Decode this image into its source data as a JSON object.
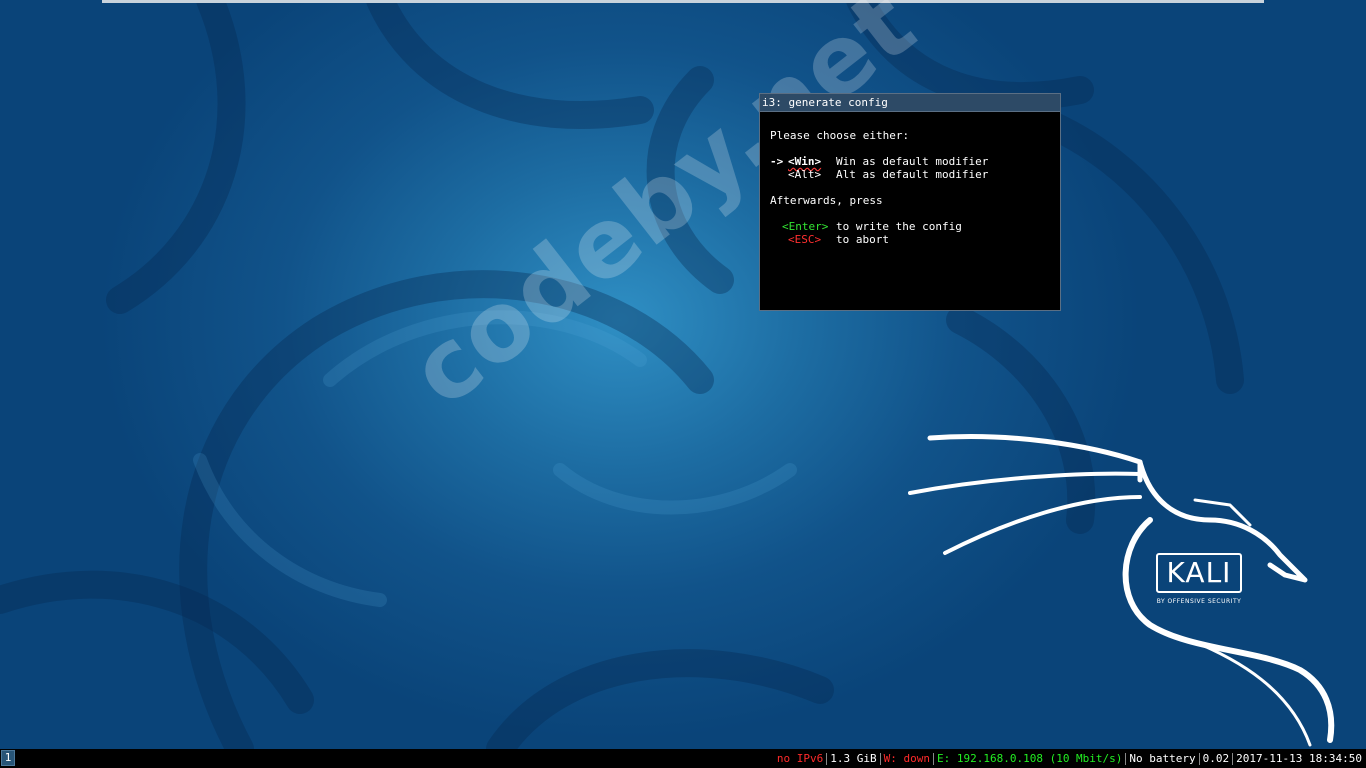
{
  "dialog": {
    "title": "i3: generate config",
    "prompt": "Please choose either:",
    "options": [
      {
        "arrow": "->",
        "key": "<Win>",
        "description": "Win as default modifier"
      },
      {
        "arrow": "",
        "key": "<Alt>",
        "description": "Alt as default modifier"
      }
    ],
    "afterwards": "Afterwards, press",
    "actions": [
      {
        "key": "<Enter>",
        "description": "to write the config",
        "color": "#33e433"
      },
      {
        "key": "<ESC>",
        "description": "to abort",
        "color": "#ff3030"
      }
    ]
  },
  "desktop": {
    "watermark": "codeby.net",
    "logo_wordmark": "KALI",
    "logo_tagline": "BY OFFENSIVE SECURITY"
  },
  "bar": {
    "workspace": "1",
    "status": {
      "ipv6": "no IPv6",
      "disk": "1.3 GiB",
      "wireless": "W: down",
      "ethernet": "E: 192.168.0.108 (10 Mbit/s)",
      "battery": "No battery",
      "load": "0.02",
      "datetime": "2017-11-13 18:34:50"
    },
    "colors": {
      "bad": "#ff2a2a",
      "good": "#22ee22",
      "focused_workspace": "#285577"
    }
  }
}
